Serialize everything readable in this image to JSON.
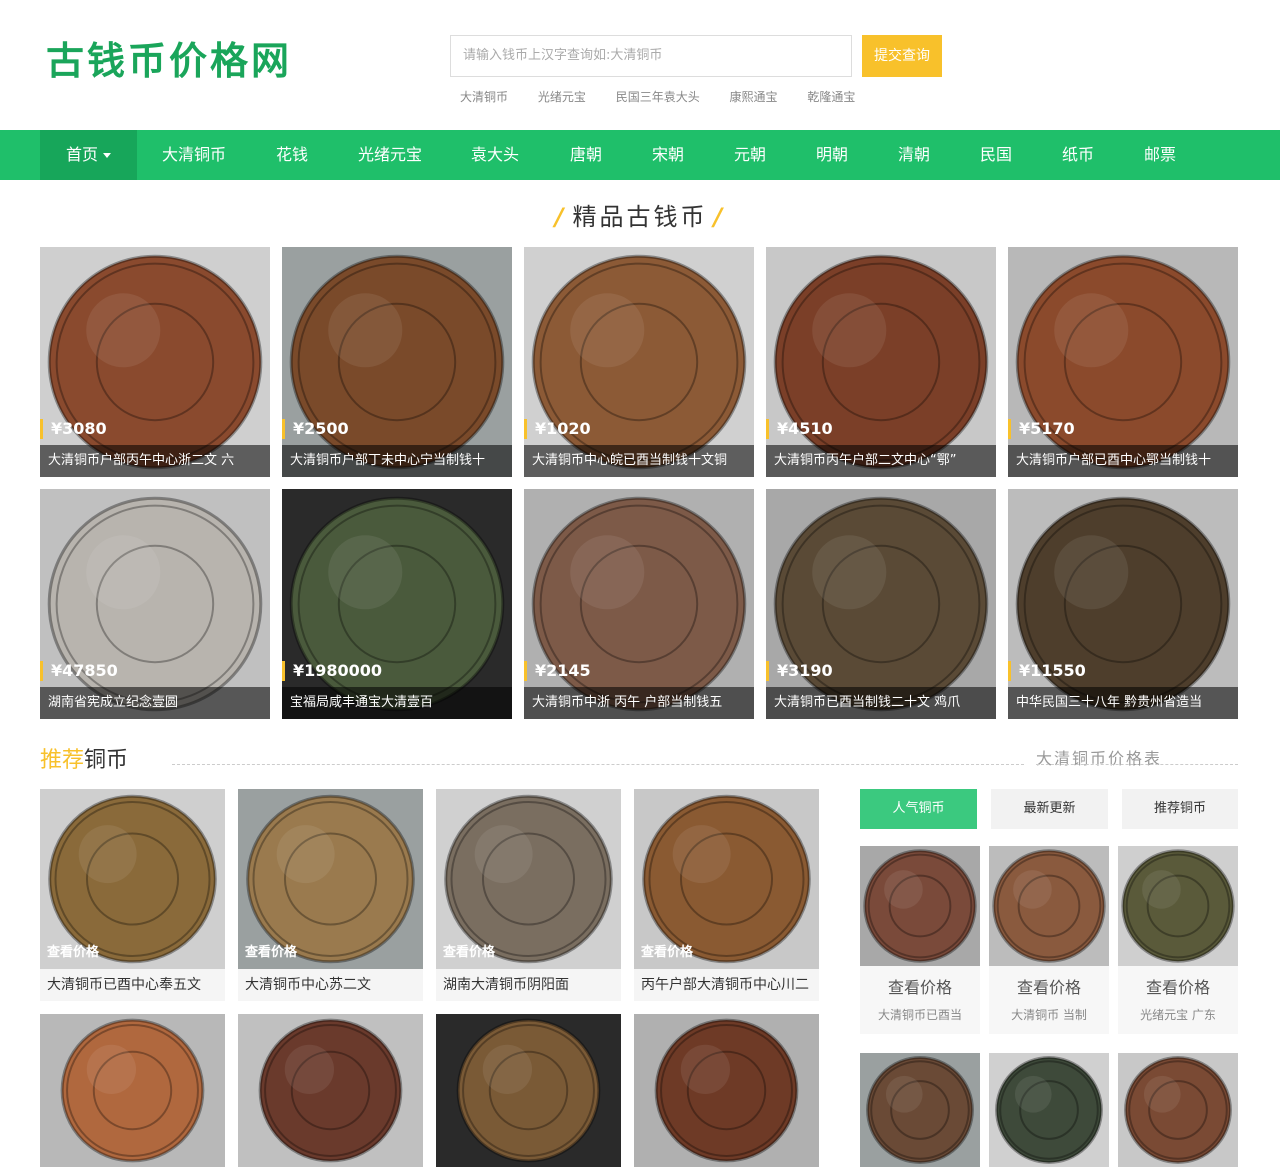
{
  "site": {
    "logo": "古钱币价格网"
  },
  "search": {
    "placeholder": "请输入钱币上汉字查询如:大清铜币",
    "button": "提交查询",
    "hot": [
      "大清铜币",
      "光绪元宝",
      "民国三年袁大头",
      "康熙通宝",
      "乾隆通宝"
    ]
  },
  "nav": [
    "首页",
    "大清铜币",
    "花钱",
    "光绪元宝",
    "袁大头",
    "唐朝",
    "宋朝",
    "元朝",
    "明朝",
    "清朝",
    "民国",
    "纸币",
    "邮票"
  ],
  "featured": {
    "title": "精品古钱币",
    "items": [
      {
        "price": "¥3080",
        "caption": "大清铜币户部丙午中心浙二文 六"
      },
      {
        "price": "¥2500",
        "caption": "大清铜币户部丁未中心宁当制钱十"
      },
      {
        "price": "¥1020",
        "caption": "大清铜币中心皖已酉当制钱十文铜"
      },
      {
        "price": "¥4510",
        "caption": "大清铜币丙午户部二文中心“鄂”"
      },
      {
        "price": "¥5170",
        "caption": "大清铜币户部已酉中心鄂当制钱十"
      },
      {
        "price": "¥47850",
        "caption": "湖南省宪成立纪念壹圆"
      },
      {
        "price": "¥1980000",
        "caption": "宝福局咸丰通宝大清壹百"
      },
      {
        "price": "¥2145",
        "caption": "大清铜币中浙 丙午 户部当制钱五"
      },
      {
        "price": "¥3190",
        "caption": "大清铜币已酉当制钱二十文 鸡爪"
      },
      {
        "price": "¥11550",
        "caption": "中华民国三十八年 黔贵州省造当"
      }
    ]
  },
  "recommend": {
    "title_hl": "推荐",
    "title_rest": "铜币",
    "view_label": "查看价格",
    "items": [
      {
        "name": "大清铜币已酉中心奉五文"
      },
      {
        "name": "大清铜币中心苏二文"
      },
      {
        "name": "湖南大清铜币阴阳面"
      },
      {
        "name": "丙午户部大清铜币中心川二"
      }
    ]
  },
  "sidebar": {
    "link": "大清铜币价格表",
    "tabs": [
      "人气铜币",
      "最新更新",
      "推荐铜币"
    ],
    "view_label": "查看价格",
    "items": [
      {
        "name": "大清铜币已酉当"
      },
      {
        "name": "大清铜币 当制"
      },
      {
        "name": "光绪元宝 广东"
      }
    ]
  },
  "colors": {
    "brand_green": "#1fbf6a",
    "accent_yellow": "#f8c12b"
  }
}
